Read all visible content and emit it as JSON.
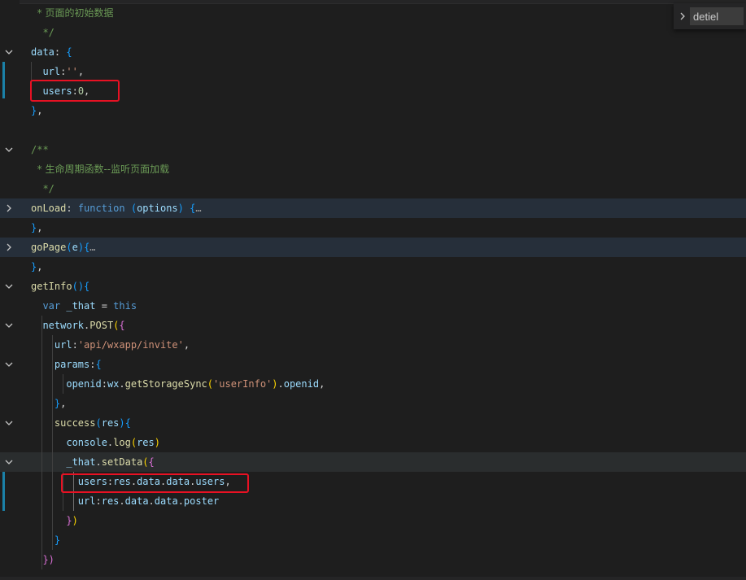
{
  "find": {
    "value": "detiel",
    "toggle_icon": "chevron-right-icon"
  },
  "colors": {
    "background": "#1e1e1e",
    "highlight_line": "#262f3a",
    "annotation_border": "#e81123",
    "modified_bar": "#1b81a8"
  },
  "lines": [
    {
      "fold": "",
      "tokens": [
        {
          "t": "  * 页面的初始数据",
          "c": "comment-cn"
        }
      ]
    },
    {
      "fold": "",
      "tokens": [
        {
          "t": "  */",
          "c": "comment"
        }
      ]
    },
    {
      "fold": "down",
      "tokens": [
        {
          "t": "data",
          "c": "prop"
        },
        {
          "t": ": ",
          "c": "punc"
        },
        {
          "t": "{",
          "c": "br2"
        }
      ]
    },
    {
      "fold": "",
      "tokens": [
        {
          "t": "  url",
          "c": "prop"
        },
        {
          "t": ":",
          "c": "punc"
        },
        {
          "t": "''",
          "c": "str"
        },
        {
          "t": ",",
          "c": "punc"
        }
      ]
    },
    {
      "fold": "",
      "tokens": [
        {
          "t": "  users",
          "c": "prop"
        },
        {
          "t": ":",
          "c": "punc"
        },
        {
          "t": "0",
          "c": "num"
        },
        {
          "t": ",",
          "c": "punc"
        }
      ]
    },
    {
      "fold": "",
      "tokens": [
        {
          "t": "}",
          "c": "br2"
        },
        {
          "t": ",",
          "c": "punc"
        }
      ]
    },
    {
      "fold": "",
      "tokens": []
    },
    {
      "fold": "down",
      "tokens": [
        {
          "t": "/**",
          "c": "comment"
        }
      ]
    },
    {
      "fold": "",
      "tokens": [
        {
          "t": "  * 生命周期函数--监听页面加载",
          "c": "comment-cn"
        }
      ]
    },
    {
      "fold": "",
      "tokens": [
        {
          "t": "  */",
          "c": "comment"
        }
      ]
    },
    {
      "fold": "right",
      "tokens": [
        {
          "t": "onLoad",
          "c": "prop-y"
        },
        {
          "t": ": ",
          "c": "punc"
        },
        {
          "t": "function",
          "c": "kw"
        },
        {
          "t": " ",
          "c": "punc"
        },
        {
          "t": "(",
          "c": "br2"
        },
        {
          "t": "options",
          "c": "var"
        },
        {
          "t": ")",
          "c": "br2"
        },
        {
          "t": " ",
          "c": "punc"
        },
        {
          "t": "{",
          "c": "br2"
        },
        {
          "t": "…",
          "c": "ell"
        }
      ]
    },
    {
      "fold": "",
      "tokens": [
        {
          "t": "}",
          "c": "br2"
        },
        {
          "t": ",",
          "c": "punc"
        }
      ]
    },
    {
      "fold": "right",
      "tokens": [
        {
          "t": "goPage",
          "c": "fn"
        },
        {
          "t": "(",
          "c": "br2"
        },
        {
          "t": "e",
          "c": "var"
        },
        {
          "t": ")",
          "c": "br2"
        },
        {
          "t": "{",
          "c": "br2"
        },
        {
          "t": "…",
          "c": "ell"
        }
      ]
    },
    {
      "fold": "",
      "tokens": [
        {
          "t": "}",
          "c": "br2"
        },
        {
          "t": ",",
          "c": "punc"
        }
      ]
    },
    {
      "fold": "down",
      "tokens": [
        {
          "t": "getInfo",
          "c": "fn"
        },
        {
          "t": "(",
          "c": "br2"
        },
        {
          "t": ")",
          "c": "br2"
        },
        {
          "t": "{",
          "c": "br2"
        }
      ]
    },
    {
      "fold": "",
      "tokens": [
        {
          "t": "  var",
          "c": "kw"
        },
        {
          "t": " _that ",
          "c": "var"
        },
        {
          "t": "= ",
          "c": "punc"
        },
        {
          "t": "this",
          "c": "kw"
        }
      ]
    },
    {
      "fold": "down",
      "tokens": [
        {
          "t": "  network",
          "c": "var"
        },
        {
          "t": ".",
          "c": "punc"
        },
        {
          "t": "POST",
          "c": "fn"
        },
        {
          "t": "(",
          "c": "br3"
        },
        {
          "t": "{",
          "c": "br1"
        }
      ]
    },
    {
      "fold": "",
      "tokens": [
        {
          "t": "    url",
          "c": "prop"
        },
        {
          "t": ":",
          "c": "punc"
        },
        {
          "t": "'api/wxapp/invite'",
          "c": "str"
        },
        {
          "t": ",",
          "c": "punc"
        }
      ]
    },
    {
      "fold": "down",
      "tokens": [
        {
          "t": "    params",
          "c": "prop"
        },
        {
          "t": ":",
          "c": "punc"
        },
        {
          "t": "{",
          "c": "br2"
        }
      ]
    },
    {
      "fold": "",
      "tokens": [
        {
          "t": "      openid",
          "c": "prop"
        },
        {
          "t": ":",
          "c": "punc"
        },
        {
          "t": "wx",
          "c": "var"
        },
        {
          "t": ".",
          "c": "punc"
        },
        {
          "t": "getStorageSync",
          "c": "fn"
        },
        {
          "t": "(",
          "c": "br3"
        },
        {
          "t": "'userInfo'",
          "c": "str"
        },
        {
          "t": ")",
          "c": "br3"
        },
        {
          "t": ".",
          "c": "punc"
        },
        {
          "t": "openid",
          "c": "prop"
        },
        {
          "t": ",",
          "c": "punc"
        }
      ]
    },
    {
      "fold": "",
      "tokens": [
        {
          "t": "    }",
          "c": "br2"
        },
        {
          "t": ",",
          "c": "punc"
        }
      ]
    },
    {
      "fold": "down",
      "tokens": [
        {
          "t": "    success",
          "c": "fn"
        },
        {
          "t": "(",
          "c": "br2"
        },
        {
          "t": "res",
          "c": "var"
        },
        {
          "t": ")",
          "c": "br2"
        },
        {
          "t": "{",
          "c": "br2"
        }
      ]
    },
    {
      "fold": "",
      "tokens": [
        {
          "t": "      console",
          "c": "var"
        },
        {
          "t": ".",
          "c": "punc"
        },
        {
          "t": "log",
          "c": "fn"
        },
        {
          "t": "(",
          "c": "br3"
        },
        {
          "t": "res",
          "c": "var"
        },
        {
          "t": ")",
          "c": "br3"
        }
      ]
    },
    {
      "fold": "down",
      "tokens": [
        {
          "t": "      _that",
          "c": "var"
        },
        {
          "t": ".",
          "c": "punc"
        },
        {
          "t": "setData",
          "c": "fn"
        },
        {
          "t": "(",
          "c": "br3"
        },
        {
          "t": "{",
          "c": "br1"
        }
      ]
    },
    {
      "fold": "",
      "tokens": [
        {
          "t": "        users",
          "c": "prop"
        },
        {
          "t": ":",
          "c": "punc"
        },
        {
          "t": "res",
          "c": "var"
        },
        {
          "t": ".",
          "c": "punc"
        },
        {
          "t": "data",
          "c": "prop"
        },
        {
          "t": ".",
          "c": "punc"
        },
        {
          "t": "data",
          "c": "prop"
        },
        {
          "t": ".",
          "c": "punc"
        },
        {
          "t": "users",
          "c": "prop"
        },
        {
          "t": ",",
          "c": "punc"
        }
      ]
    },
    {
      "fold": "",
      "tokens": [
        {
          "t": "        url",
          "c": "prop"
        },
        {
          "t": ":",
          "c": "punc"
        },
        {
          "t": "res",
          "c": "var"
        },
        {
          "t": ".",
          "c": "punc"
        },
        {
          "t": "data",
          "c": "prop"
        },
        {
          "t": ".",
          "c": "punc"
        },
        {
          "t": "data",
          "c": "prop"
        },
        {
          "t": ".",
          "c": "punc"
        },
        {
          "t": "poster",
          "c": "prop"
        }
      ]
    },
    {
      "fold": "",
      "tokens": [
        {
          "t": "      }",
          "c": "br1"
        },
        {
          "t": ")",
          "c": "br3"
        }
      ]
    },
    {
      "fold": "",
      "tokens": [
        {
          "t": "    }",
          "c": "br2"
        }
      ]
    },
    {
      "fold": "",
      "tokens": [
        {
          "t": "  })",
          "c": "br1"
        }
      ]
    }
  ]
}
